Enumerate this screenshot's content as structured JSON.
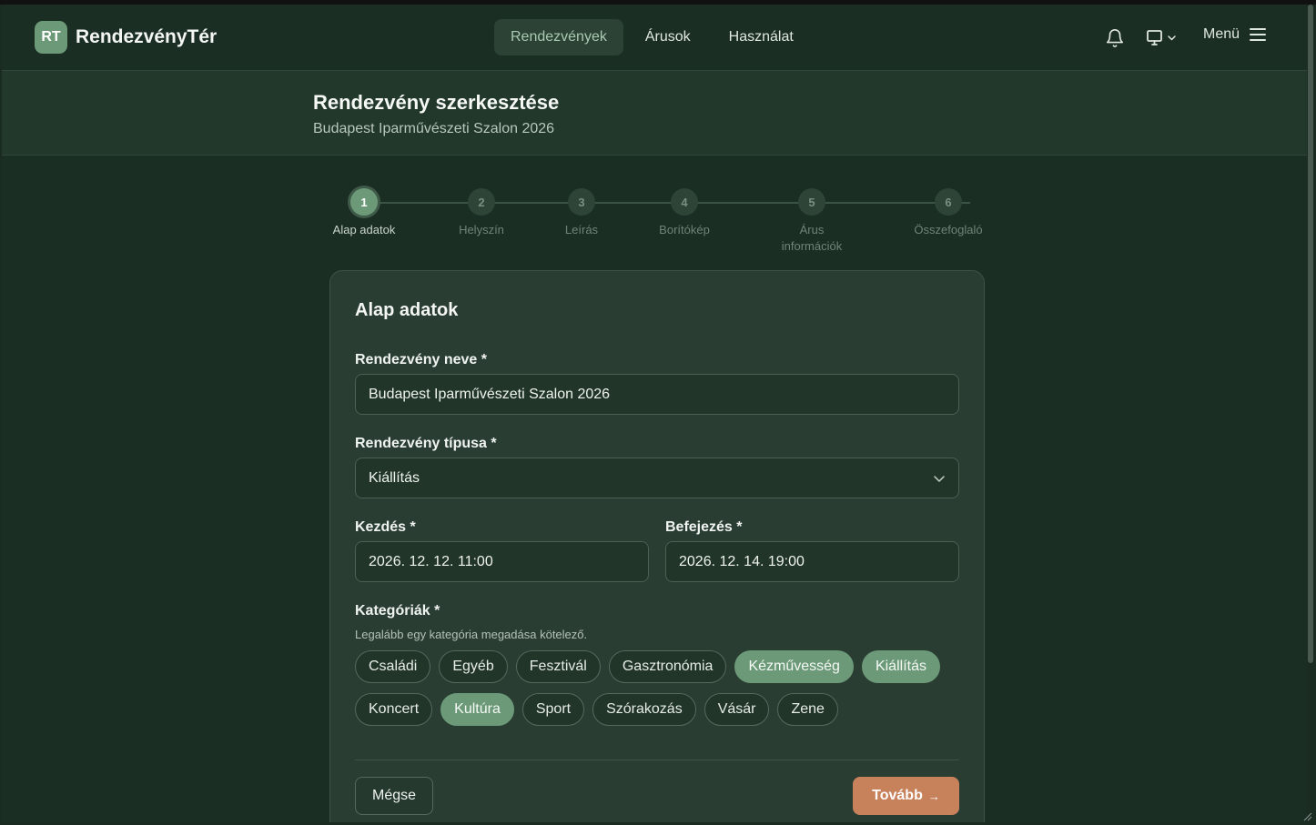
{
  "header": {
    "logo_initials": "RT",
    "app_name": "RendezvényTér",
    "nav": [
      {
        "label": "Rendezvények",
        "active": true
      },
      {
        "label": "Árusok",
        "active": false
      },
      {
        "label": "Használat",
        "active": false
      }
    ],
    "menu_label": "Menü",
    "icons": [
      "bell-icon",
      "monitor-icon",
      "chevron-down-icon",
      "hamburger-icon"
    ]
  },
  "page": {
    "title": "Rendezvény szerkesztése",
    "subtitle": "Budapest Iparművészeti Szalon 2026"
  },
  "stepper": {
    "current": 1,
    "steps": [
      {
        "number": "1",
        "label": "Alap adatok"
      },
      {
        "number": "2",
        "label": "Helyszín"
      },
      {
        "number": "3",
        "label": "Leírás"
      },
      {
        "number": "4",
        "label": "Borítókép"
      },
      {
        "number": "5",
        "label": "Árus információk"
      },
      {
        "number": "6",
        "label": "Összefoglaló"
      }
    ]
  },
  "form": {
    "section_title": "Alap adatok",
    "name_label": "Rendezvény neve *",
    "name_value": "Budapest Iparművészeti Szalon 2026",
    "type_label": "Rendezvény típusa *",
    "type_value": "Kiállítás",
    "start_label": "Kezdés *",
    "start_value": "2026. 12. 12. 11:00",
    "end_label": "Befejezés *",
    "end_value": "2026. 12. 14. 19:00",
    "categories_label": "Kategóriák *",
    "categories_hint": "Legalább egy kategória megadása kötelező.",
    "categories_row1": [
      {
        "label": "Családi",
        "selected": false
      },
      {
        "label": "Egyéb",
        "selected": false
      },
      {
        "label": "Fesztivál",
        "selected": false
      },
      {
        "label": "Gasztronómia",
        "selected": false
      },
      {
        "label": "Kézművesség",
        "selected": true
      },
      {
        "label": "Kiállítás",
        "selected": true
      }
    ],
    "categories_row2": [
      {
        "label": "Koncert",
        "selected": false
      },
      {
        "label": "Kultúra",
        "selected": true
      },
      {
        "label": "Sport",
        "selected": false
      },
      {
        "label": "Szórakozás",
        "selected": false
      },
      {
        "label": "Vásár",
        "selected": false
      },
      {
        "label": "Zene",
        "selected": false
      }
    ],
    "cancel_label": "Mégse",
    "next_label": "Tovább",
    "next_arrow": "→"
  },
  "colors": {
    "accent": "#6c9a78",
    "primary_button": "#c7815b",
    "background": "#1b2e23"
  }
}
